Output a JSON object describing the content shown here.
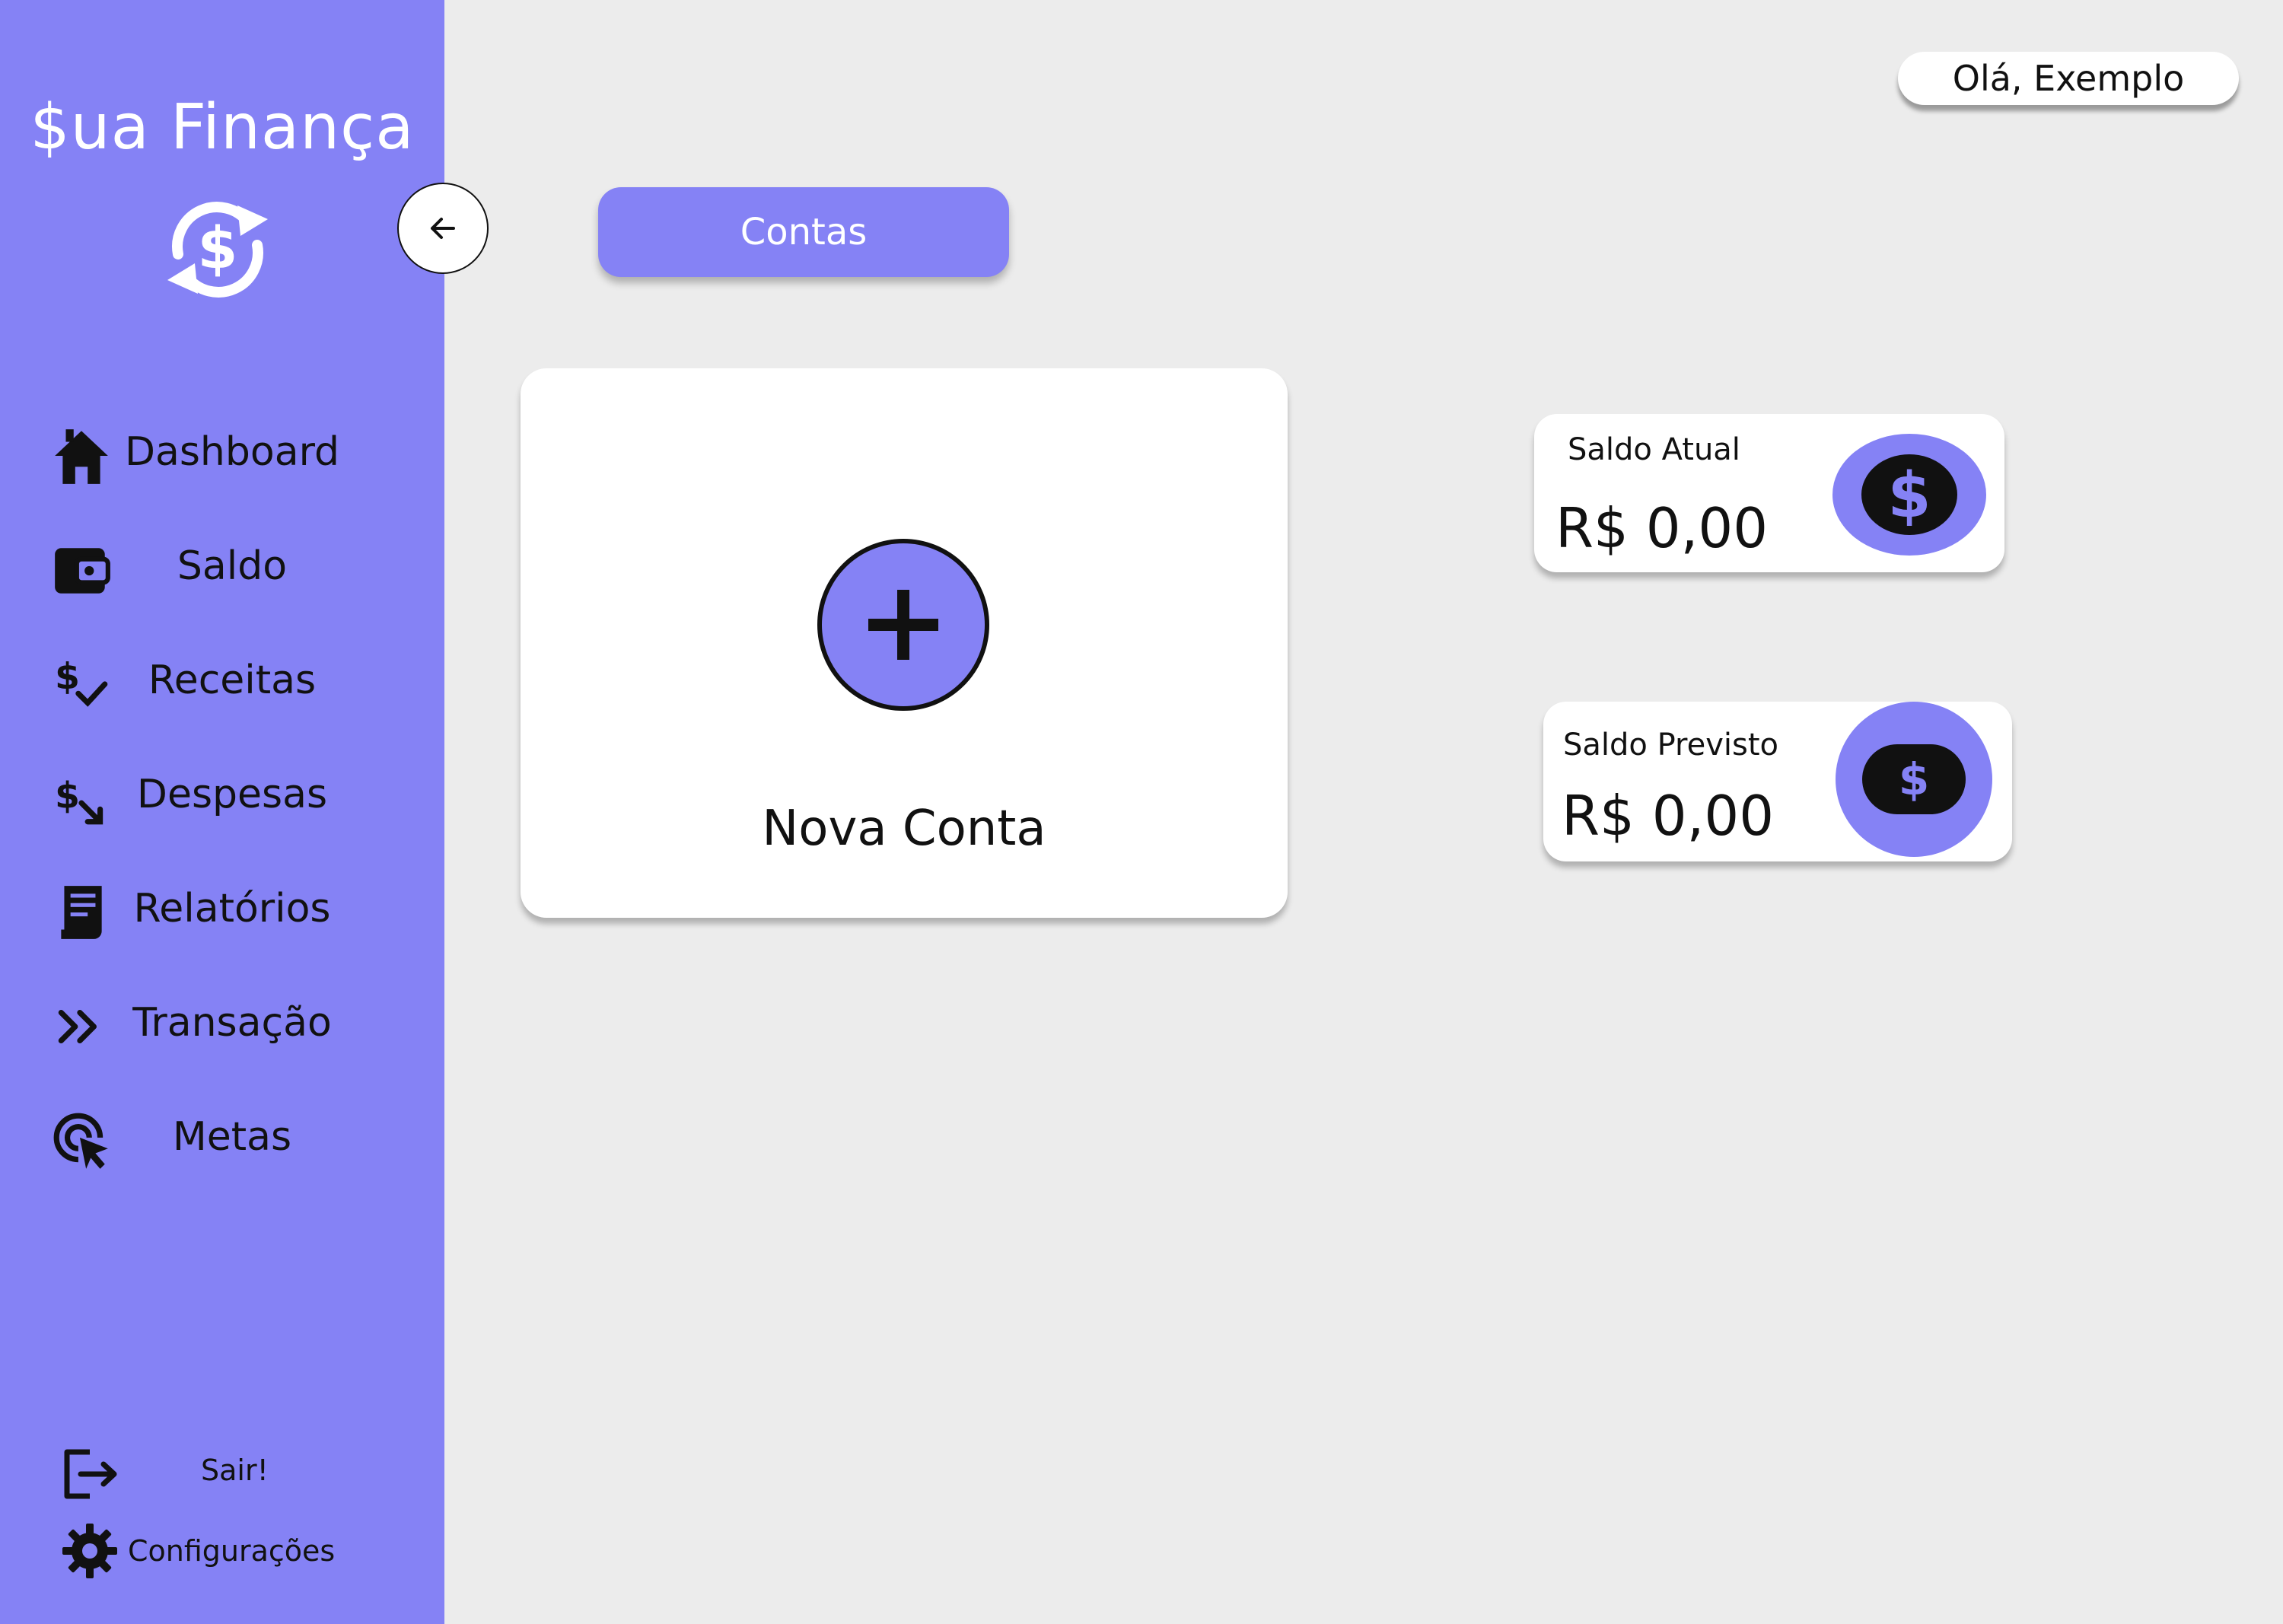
{
  "app": {
    "brand": "$ua Finança",
    "accent_color": "#8582f5",
    "background_color": "#ececec",
    "logo_icon": "currency-exchange-icon"
  },
  "sidebar": {
    "collapse_icon": "arrow-left-icon",
    "items": [
      {
        "label": "Dashboard",
        "icon": "home-icon"
      },
      {
        "label": "Saldo",
        "icon": "wallet-icon"
      },
      {
        "label": "Receitas",
        "icon": "dollar-check-icon"
      },
      {
        "label": "Despesas",
        "icon": "dollar-arrow-down-icon"
      },
      {
        "label": "Relatórios",
        "icon": "receipt-icon"
      },
      {
        "label": "Transação",
        "icon": "double-chevron-right-icon"
      },
      {
        "label": "Metas",
        "icon": "target-cursor-icon"
      }
    ],
    "logout_label": "Sair!",
    "settings_label": "Configurações"
  },
  "header": {
    "greeting": "Olá, Exemplo"
  },
  "main": {
    "active_tab": "Contas",
    "new_account_label": "Nova Conta",
    "cards": [
      {
        "title": "Saldo Atual",
        "value": "R$ 0,00",
        "icon": "dollar-coin-icon"
      },
      {
        "title": "Saldo Previsto",
        "value": "R$ 0,00",
        "icon": "dollar-bill-icon"
      }
    ]
  }
}
